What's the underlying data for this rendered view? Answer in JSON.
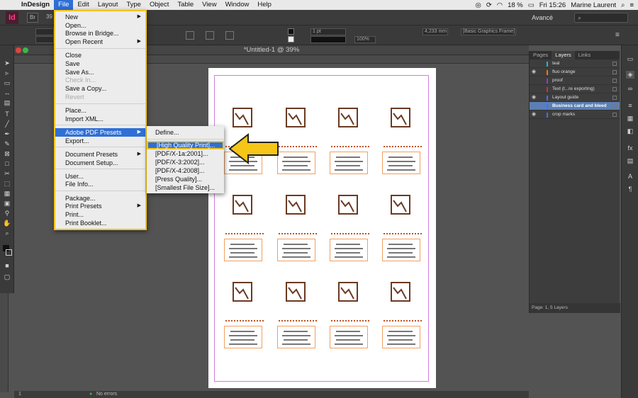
{
  "menubar": {
    "app_name": "InDesign",
    "menus": [
      "File",
      "Edit",
      "Layout",
      "Type",
      "Object",
      "Table",
      "View",
      "Window",
      "Help"
    ],
    "battery": "18 %",
    "clock": "Fri 15:26",
    "user": "Marine Laurent"
  },
  "appbar": {
    "logo": "Id",
    "workspace": "Avancé",
    "zoom_partial": "39"
  },
  "controlbar": {
    "stroke_weight": "1 pt",
    "percent": "100%",
    "measure": "4,233 mm",
    "style": "[Basic Graphics Frame]"
  },
  "document": {
    "title": "*Untitled-1 @ 39%"
  },
  "status": {
    "page": "1",
    "preflight": "No errors"
  },
  "file_menu": {
    "items": [
      {
        "label": "New",
        "submenu": true
      },
      {
        "label": "Open..."
      },
      {
        "label": "Browse in Bridge..."
      },
      {
        "label": "Open Recent",
        "submenu": true
      },
      {
        "label": "Close"
      },
      {
        "label": "Save"
      },
      {
        "label": "Save As..."
      },
      {
        "label": "Check In...",
        "disabled": true
      },
      {
        "label": "Save a Copy..."
      },
      {
        "label": "Revert",
        "disabled": true
      },
      {
        "label": "Place..."
      },
      {
        "label": "Import XML..."
      },
      {
        "label": "Adobe PDF Presets",
        "submenu": true,
        "highlighted": true
      },
      {
        "label": "Export..."
      },
      {
        "label": "Document Presets",
        "submenu": true
      },
      {
        "label": "Document Setup..."
      },
      {
        "label": "User..."
      },
      {
        "label": "File Info..."
      },
      {
        "label": "Package..."
      },
      {
        "label": "Print Presets",
        "submenu": true
      },
      {
        "label": "Print..."
      },
      {
        "label": "Print Booklet..."
      }
    ]
  },
  "pdf_presets_submenu": {
    "items": [
      {
        "label": "Define..."
      },
      {
        "label": "[High Quality Print]...",
        "highlighted": true
      },
      {
        "label": "[PDF/X-1a:2001]..."
      },
      {
        "label": "[PDF/X-3:2002]..."
      },
      {
        "label": "[PDF/X-4:2008]..."
      },
      {
        "label": "[Press Quality]..."
      },
      {
        "label": "[Smallest File Size]..."
      }
    ]
  },
  "layers_panel": {
    "tabs": [
      "Pages",
      "Layers",
      "Links"
    ],
    "active_tab": "Layers",
    "layers": [
      {
        "name": "teal",
        "color": "#2bb5c9",
        "visible": false
      },
      {
        "name": "fluo orange",
        "color": "#ff7a00",
        "visible": true
      },
      {
        "name": "proof",
        "color": "#8a3fd1",
        "visible": false
      },
      {
        "name": "Text (t...re exporting)",
        "color": "#e02b2b",
        "visible": false
      },
      {
        "name": "Layout guide",
        "color": "#4a6cff",
        "visible": true
      },
      {
        "name": "Business card and bleed",
        "color": "#4a6cff",
        "visible": false,
        "selected": true
      },
      {
        "name": "crop marks",
        "color": "#4a6cff",
        "visible": true
      }
    ],
    "footer": "Page: 1, 5 Layers"
  },
  "colors": {
    "highlight_yellow": "#f5c518",
    "menu_blue": "#2f6fd6",
    "logo_brown": "#6b3a22",
    "guide_magenta": "#d27be0"
  }
}
